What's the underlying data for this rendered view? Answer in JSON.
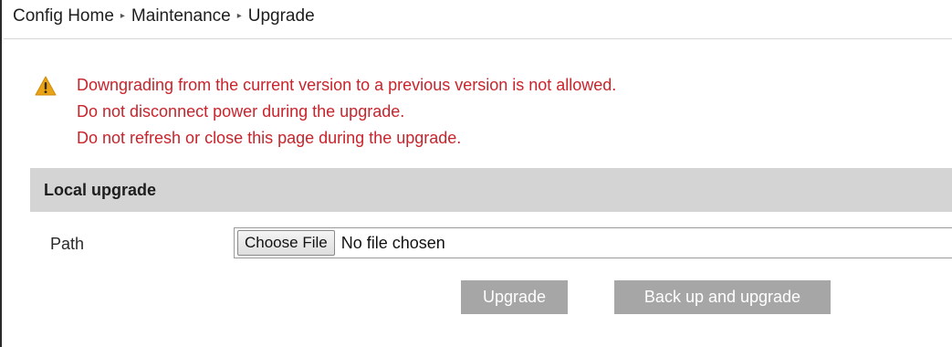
{
  "breadcrumb": {
    "items": [
      "Config Home",
      "Maintenance",
      "Upgrade"
    ],
    "separator": "▸"
  },
  "warning": {
    "icon": "warning-triangle-icon",
    "icon_color": "#e8a317",
    "text_color": "#c8242c",
    "lines": [
      "Downgrading from the current version to a previous version is not allowed.",
      "Do not disconnect power during the upgrade.",
      "Do not refresh or close this page during the upgrade."
    ]
  },
  "section": {
    "title": "Local upgrade",
    "background": "#d4d4d4"
  },
  "path": {
    "label": "Path",
    "choose_button_label": "Choose File",
    "file_status": "No file chosen"
  },
  "actions": {
    "upgrade_label": "Upgrade",
    "backup_upgrade_label": "Back up and upgrade",
    "button_color": "#a6a6a6"
  }
}
